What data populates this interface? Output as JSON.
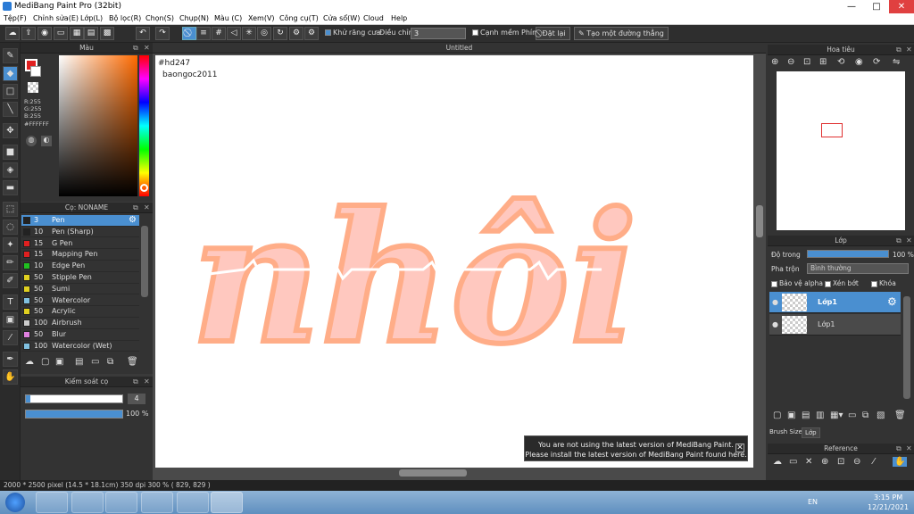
{
  "window": {
    "title": "MediBang Paint Pro (32bit)",
    "minimize": "—",
    "maximize": "□",
    "close": "✕"
  },
  "menu": [
    "Tệp(F)",
    "Chỉnh sửa(E)",
    "Lớp(L)",
    "Bộ lọc(R)",
    "Chọn(S)",
    "Chụp(N)",
    "Màu (C)",
    "Xem(V)",
    "Công cụ(T)",
    "Cửa sổ(W)",
    "Cloud",
    "Help"
  ],
  "toolbar": {
    "antialias_label": "Khử răng cưa",
    "adjust_label": "Điều chỉnh",
    "adjust_value": "3",
    "edge_label": "Cạnh mềm",
    "key_label": "Phím",
    "reset_label": "Đặt lại",
    "straight_label": "Tạo một đường thẳng"
  },
  "color_panel": {
    "title": "Màu",
    "r": "R:255",
    "g": "G:255",
    "b": "B:255",
    "hex": "#FFFFFF"
  },
  "brush_panel": {
    "title": "Cọ: NONAME",
    "brushes": [
      {
        "size": "3",
        "name": "Pen",
        "color": "#222222"
      },
      {
        "size": "10",
        "name": "Pen (Sharp)",
        "color": "#222222"
      },
      {
        "size": "15",
        "name": "G Pen",
        "color": "#e02020"
      },
      {
        "size": "15",
        "name": "Mapping Pen",
        "color": "#e02020"
      },
      {
        "size": "10",
        "name": "Edge Pen",
        "color": "#20c020"
      },
      {
        "size": "50",
        "name": "Stipple Pen",
        "color": "#e0d020"
      },
      {
        "size": "50",
        "name": "Sumi",
        "color": "#e0d020"
      },
      {
        "size": "50",
        "name": "Watercolor",
        "color": "#80c0e0"
      },
      {
        "size": "50",
        "name": "Acrylic",
        "color": "#e0d020"
      },
      {
        "size": "100",
        "name": "Airbrush",
        "color": "#cccccc"
      },
      {
        "size": "50",
        "name": "Blur",
        "color": "#e080e0"
      },
      {
        "size": "100",
        "name": "Watercolor (Wet)",
        "color": "#80c0e0"
      }
    ]
  },
  "brush_control": {
    "title": "Kiểm soát cọ",
    "size_value": "4",
    "opacity_value": "100 %"
  },
  "canvas": {
    "tab": "Untitled",
    "text_line1": "#hd247",
    "text_line2": "baongoc2011",
    "artwork": "nhôi"
  },
  "navigator": {
    "title": "Hoa tiêu"
  },
  "layer_panel": {
    "title": "Lớp",
    "opacity_label": "Độ trong",
    "opacity_value": "100 %",
    "blend_label": "Pha trộn",
    "blend_value": "Bình thường",
    "protect_alpha": "Bảo vệ alpha",
    "clip": "Xén bớt",
    "lock": "Khóa",
    "layers": [
      {
        "name": "Lớp1",
        "selected": true
      },
      {
        "name": "Lớp1",
        "selected": false
      }
    ],
    "tab_brush_size": "Brush Size",
    "tab_layer": "Lớp"
  },
  "reference": {
    "title": "Reference"
  },
  "notice": {
    "line1": "You are not using the latest version of MediBang Paint.",
    "line2": "Please install the latest version of MediBang Paint found here."
  },
  "status": {
    "text": "2000 * 2500 pixel  (14.5 * 18.1cm)  350 dpi  300 %  ( 829, 829 )"
  },
  "taskbar": {
    "lang": "EN",
    "time": "3:15 PM",
    "date": "12/21/2021"
  }
}
